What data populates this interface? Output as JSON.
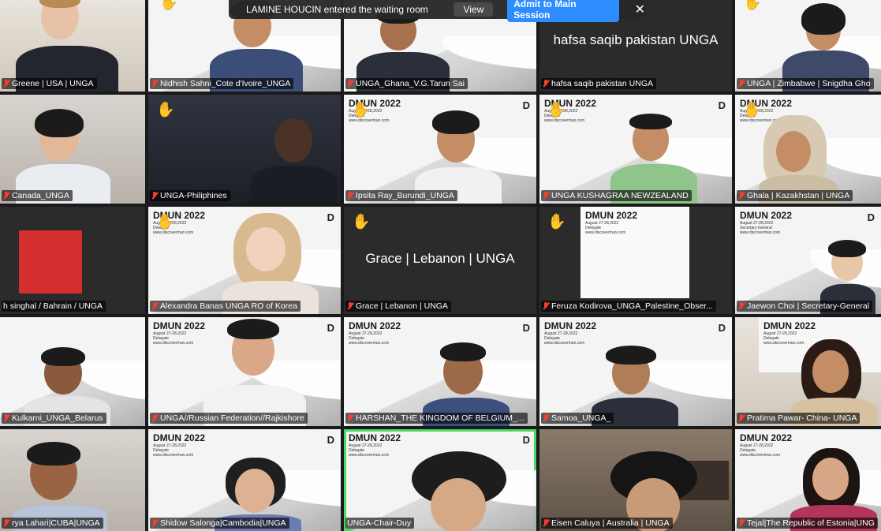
{
  "notification": {
    "message": "LAMINE HOUCIN entered the waiting room",
    "view_label": "View",
    "admit_label": "Admit to Main Session",
    "close_glyph": "✕"
  },
  "slide": {
    "title": "DMUN 2022",
    "lines": "August 27-28,2022\nDelegate\nwww.discovermun.com",
    "lines_sg": "August 27-28,2022\nSecretary-General\nwww.discovermun.com",
    "mark": "D"
  },
  "icons": {
    "hand": "✋",
    "hand_name": "raised-hand-icon",
    "mic_name": "mic-muted-icon"
  },
  "colors": {
    "accent": "#2d8cff",
    "muted_red": "#ff3b30",
    "active_speaker": "#4cd964",
    "blank_avatar": "#d32f2f"
  },
  "participants": [
    {
      "name": "Greene | USA | UNGA"
    },
    {
      "name": "Nidhish Sahni_Cote d'Ivoire_UNGA"
    },
    {
      "name": "UNGA_Ghana_V.G.Tarun Sai"
    },
    {
      "name": "hafsa saqib pakistan UNGA",
      "center": "hafsa saqib pakistan UNGA"
    },
    {
      "name": "UNGA | Zimbabwe | Snigdha Gho"
    },
    {
      "name": "Canada_UNGA"
    },
    {
      "name": "UNGA-Philiphines"
    },
    {
      "name": "Ipsita Ray_Burundi_UNGA"
    },
    {
      "name": "UNGA KUSHAGRAA NEWZEALAND"
    },
    {
      "name": "Ghala | Kazakhstan | UNGA"
    },
    {
      "name": "h singhal / Bahrain / UNGA"
    },
    {
      "name": "Alexandra Banas UNGA RO of Korea"
    },
    {
      "name": "Grace | Lebanon | UNGA",
      "center": "Grace | Lebanon | UNGA"
    },
    {
      "name": "Feruza Kodirova_UNGA_Palestine_Obser..."
    },
    {
      "name": "Jaewon Choi | Secretary-General"
    },
    {
      "name": "Kulkarni_UNGA_Belarus"
    },
    {
      "name": "UNGA//Russian Federation//Rajkishore"
    },
    {
      "name": "HARSHAN_THE KINGDOM OF BELGIUM_..."
    },
    {
      "name": "Samoa_UNGA_"
    },
    {
      "name": "Pratima Pawar- China- UNGA"
    },
    {
      "name": "rya Lahari|CUBA|UNGA"
    },
    {
      "name": "Shidow Salonga|Cambodia|UNGA"
    },
    {
      "name": "UNGA-Chair-Duy"
    },
    {
      "name": "Eisen Caluya | Australia | UNGA"
    },
    {
      "name": "Tejal|The Republic of Estonia|UNG"
    }
  ]
}
